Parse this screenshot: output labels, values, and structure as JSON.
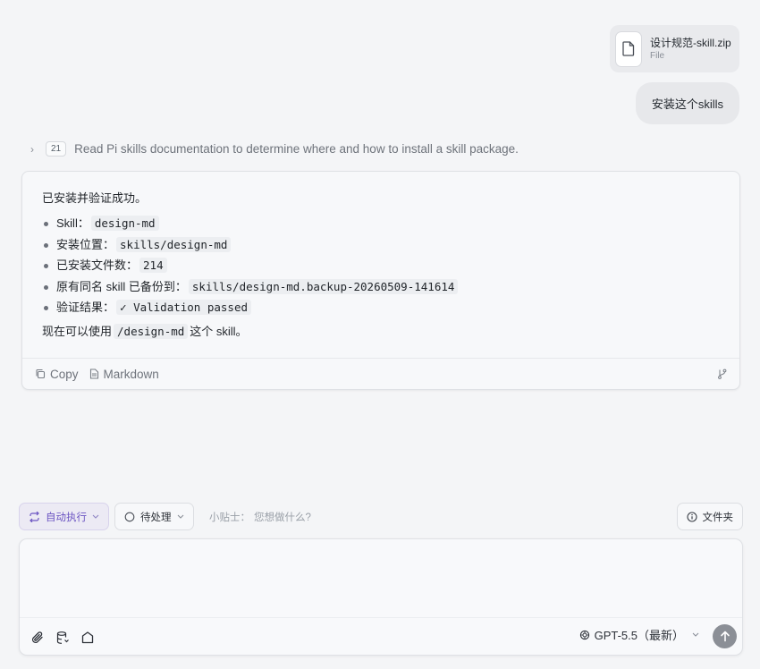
{
  "attachment": {
    "file_name": "设计规范-skill.zip",
    "file_type": "File"
  },
  "user_message": "安装这个skills",
  "tool_step": {
    "count": "21",
    "summary": "Read Pi skills documentation to determine where and how to install a skill package."
  },
  "assistant": {
    "lead": "已安装并验证成功。",
    "items": [
      {
        "label": "Skill：",
        "value": "design-md"
      },
      {
        "label": "安装位置：",
        "value": "skills/design-md"
      },
      {
        "label": "已安装文件数：",
        "value": "214"
      },
      {
        "label": "原有同名 skill 已备份到：",
        "value": "skills/design-md.backup-20260509-141614"
      },
      {
        "label": "验证结果：",
        "value": "✓ Validation passed"
      }
    ],
    "tail_before": "现在可以使用",
    "tail_code": "/design-md",
    "tail_after": "这个 skill。",
    "copy_label": "Copy",
    "markdown_label": "Markdown"
  },
  "toolbar": {
    "auto_label": "自动执行",
    "pending_label": "待处理",
    "tip_label": "小贴士：",
    "tip_question": "您想做什么?",
    "folder_label": "文件夹"
  },
  "composer": {
    "model_label": "GPT-5.5（最新）"
  },
  "colors": {
    "accent": "#6b54c2",
    "background": "#f4f5f7",
    "send_button": "#8b8f96"
  }
}
